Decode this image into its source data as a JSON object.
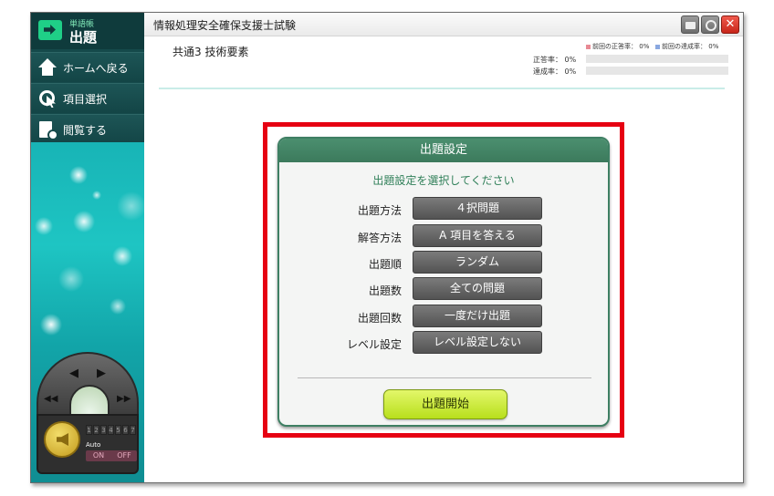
{
  "app": {
    "brand_small": "単語帳",
    "brand_big": "出題",
    "title": "情報処理安全確保支援士試験",
    "close_glyph": "✕"
  },
  "sidebar": {
    "items": [
      {
        "label": "ホームへ戻る",
        "icon": "home-icon"
      },
      {
        "label": "項目選択",
        "icon": "cursor-icon"
      },
      {
        "label": "閲覧する",
        "icon": "document-search-icon"
      }
    ]
  },
  "header": {
    "subtitle": "共通3 技術要素",
    "legend_prev_correct": "前回の正答率：",
    "legend_prev_correct_value": "0%",
    "legend_prev_achieve": "前回の達成率：",
    "legend_prev_achieve_value": "0%",
    "correct_label": "正答率：",
    "correct_value": "0%",
    "achieve_label": "達成率：",
    "achieve_value": "0%",
    "correct_fraction": 0,
    "achieve_fraction": 0
  },
  "dialog": {
    "title": "出題設定",
    "instruction": "出題設定を選択してください",
    "settings": [
      {
        "label": "出題方法",
        "value": "４択問題"
      },
      {
        "label": "解答方法",
        "value": "A 項目を答える"
      },
      {
        "label": "出題順",
        "value": "ランダム"
      },
      {
        "label": "出題数",
        "value": "全ての問題"
      },
      {
        "label": "出題回数",
        "value": "一度だけ出題"
      },
      {
        "label": "レベル設定",
        "value": "レベル設定しない"
      }
    ],
    "start_label": "出題開始"
  },
  "controller": {
    "speed_digits": [
      "1",
      "2",
      "3",
      "4",
      "5",
      "6",
      "7"
    ],
    "auto_label": "Auto",
    "on_label": "ON",
    "off_label": "OFF",
    "prev_glyph": "◀",
    "next_glyph": "▶",
    "rewind_glyph": "◀◀",
    "forward_glyph": "▶▶"
  },
  "colors": {
    "accent_green": "#3c7a5c",
    "highlight_red": "#e60012",
    "start_button": "#c9e83a",
    "legend_prev_correct": "#e88a94",
    "legend_prev_achieve": "#8aa8e0"
  }
}
